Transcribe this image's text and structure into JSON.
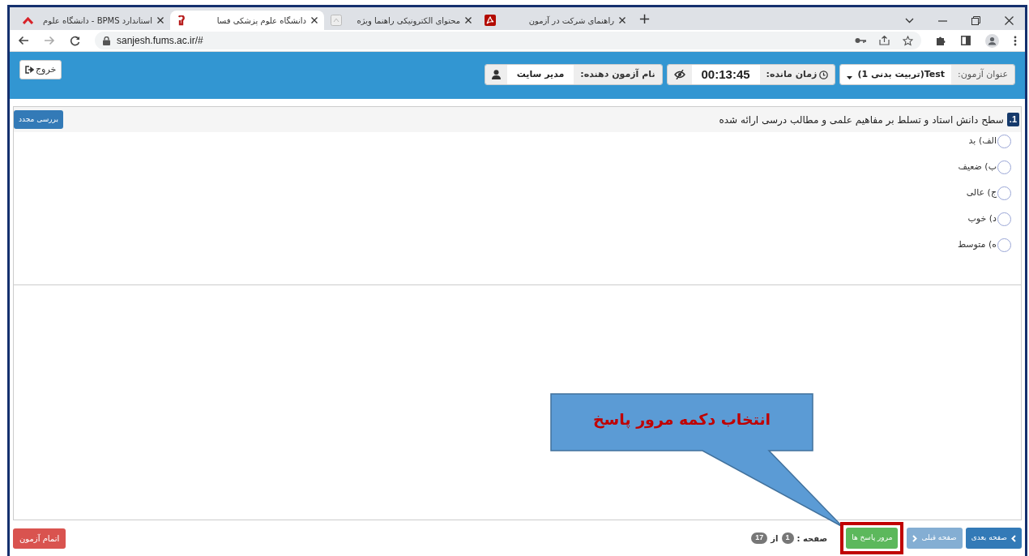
{
  "browser": {
    "tabs": [
      {
        "title": "راهنمای شرکت در آزمون",
        "selected": false
      },
      {
        "title": "محتوای الکترونیکی راهنما ویژه",
        "selected": false
      },
      {
        "title": "دانشگاه علوم پزشکی فسا",
        "selected": true
      },
      {
        "title": "استاندارد BPMS - دانشگاه علوم",
        "selected": false
      }
    ],
    "new_tab": "+",
    "url": "sanjesh.fums.ac.ir/#"
  },
  "header": {
    "exit_button": "خروج",
    "exam_title_label": "عنوان آزمون:",
    "exam_title": "Test(تربیت بدنی 1)",
    "time_label": "زمان مانده:",
    "time_left": "00:13:45",
    "examinee_label": "نام آزمون دهنده:",
    "examinee": "مدیر سایت"
  },
  "question": {
    "number": "1.",
    "text": "سطح دانش استاد و تسلط بر مفاهیم علمی و مطالب درسی ارائه شده",
    "review_button": "بررسی مجدد",
    "options": [
      {
        "label": "الف) بد",
        "selected": false
      },
      {
        "label": "ب) ضعیف",
        "selected": false
      },
      {
        "label": "ج) عالی",
        "selected": false
      },
      {
        "label": "د) خوب",
        "selected": false
      },
      {
        "label": "ه) متوسط",
        "selected": false
      }
    ]
  },
  "footer": {
    "finish_button": "اتمام آزمون",
    "nav_buttons": [
      {
        "kind": "next",
        "label": "صفحه بعدی",
        "disabled": false
      },
      {
        "kind": "prev",
        "label": "صفحه قبلی",
        "disabled": true
      },
      {
        "kind": "review",
        "label": "مرور پاسخ ها",
        "disabled": false
      }
    ],
    "page_label": "صفحه :",
    "page": "1",
    "of": "از",
    "total": "17"
  },
  "callout": {
    "text": "انتخاب  دکمه مرور پاسخ"
  }
}
